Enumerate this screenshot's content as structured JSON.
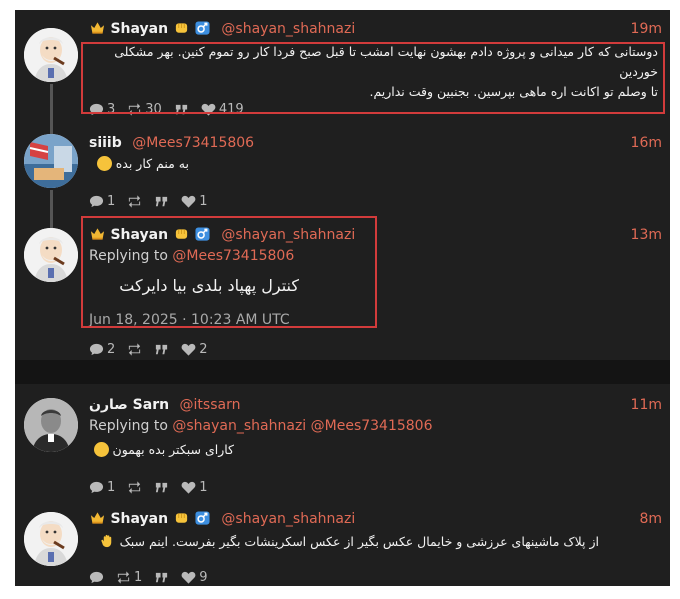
{
  "posts": [
    {
      "author": "Shayan",
      "handle": "@shayan_shahnazi",
      "time": "19m",
      "text_lines": [
        "دوستانی که کار میدانی و پروژه دادم بهشون نهایت امشب تا قبل صبح فردا کار رو تموم کنین. بهر مشکلی خوردین",
        "تا وصلم تو اکانت اره ماهی بپرسین. بجنبین وقت نداریم."
      ],
      "replies": "3",
      "reposts": "30",
      "quotes": "",
      "likes": "419"
    },
    {
      "author": "siiib",
      "handle": "@Mees73415806",
      "time": "16m",
      "text": "به منم کار بده",
      "replies": "1",
      "reposts": "",
      "quotes": "",
      "likes": "1"
    },
    {
      "author": "Shayan",
      "handle": "@shayan_shahnazi",
      "time": "13m",
      "replying_label": "Replying to",
      "replying_to": "@Mees73415806",
      "text": "کنترل پهپاد بلدی بیا دایرکت",
      "date": "Jun 18, 2025 · 10:23 AM UTC",
      "replies": "2",
      "reposts": "",
      "quotes": "",
      "likes": "2"
    },
    {
      "author": "صارن Sarn",
      "handle": "@itssarn",
      "time": "11m",
      "replying_label": "Replying to",
      "replying_to": "@shayan_shahnazi @Mees73415806",
      "text": "کارای سبکتر بده بهمون",
      "replies": "1",
      "reposts": "",
      "quotes": "",
      "likes": "1"
    },
    {
      "author": "Shayan",
      "handle": "@shayan_shahnazi",
      "time": "8m",
      "text": "از پلاک ماشینهای عرزشی و خایمال عکس بگیر از عکس اسکرینشات بگیر بفرست. اینم سبک",
      "replies": "",
      "reposts": "1",
      "quotes": "",
      "likes": "9"
    }
  ],
  "icons": {
    "reply": "speech-bubble-icon",
    "repost": "repost-arrows-icon",
    "quote": "quote-marks-icon",
    "like": "heart-icon",
    "crown": "crown-emoji-icon",
    "fist": "fist-emoji-icon",
    "male": "male-sign-icon",
    "hand": "raised-hand-emoji-icon"
  },
  "colors": {
    "background": "#1f1f1f",
    "accent": "#e06a55",
    "highlight_box": "#d23b3b",
    "text": "#f2f2f2",
    "muted": "#b9b9b9"
  }
}
